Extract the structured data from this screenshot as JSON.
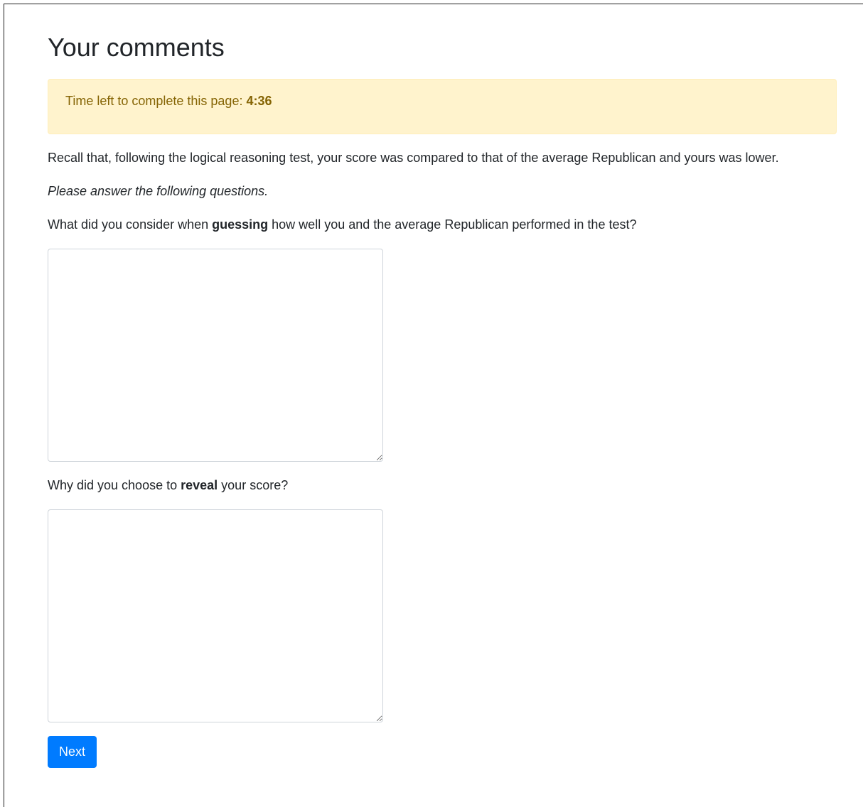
{
  "page": {
    "title": "Your comments"
  },
  "timer": {
    "label": "Time left to complete this page: ",
    "value": "4:36"
  },
  "intro": {
    "recall_text": "Recall that, following the logical reasoning test, your score was compared to that of the average Republican and yours was lower.",
    "instruction": "Please answer the following questions."
  },
  "question1": {
    "prefix": "What did you consider when ",
    "emphasis": "guessing",
    "suffix": " how well you and the average Republican performed in the test?",
    "answer_value": ""
  },
  "question2": {
    "prefix": "Why did you choose to ",
    "emphasis": "reveal",
    "suffix": " your score?",
    "answer_value": ""
  },
  "actions": {
    "next_label": "Next"
  },
  "colors": {
    "alert_bg": "#fff3cd",
    "alert_text": "#856404",
    "primary": "#007bff"
  }
}
